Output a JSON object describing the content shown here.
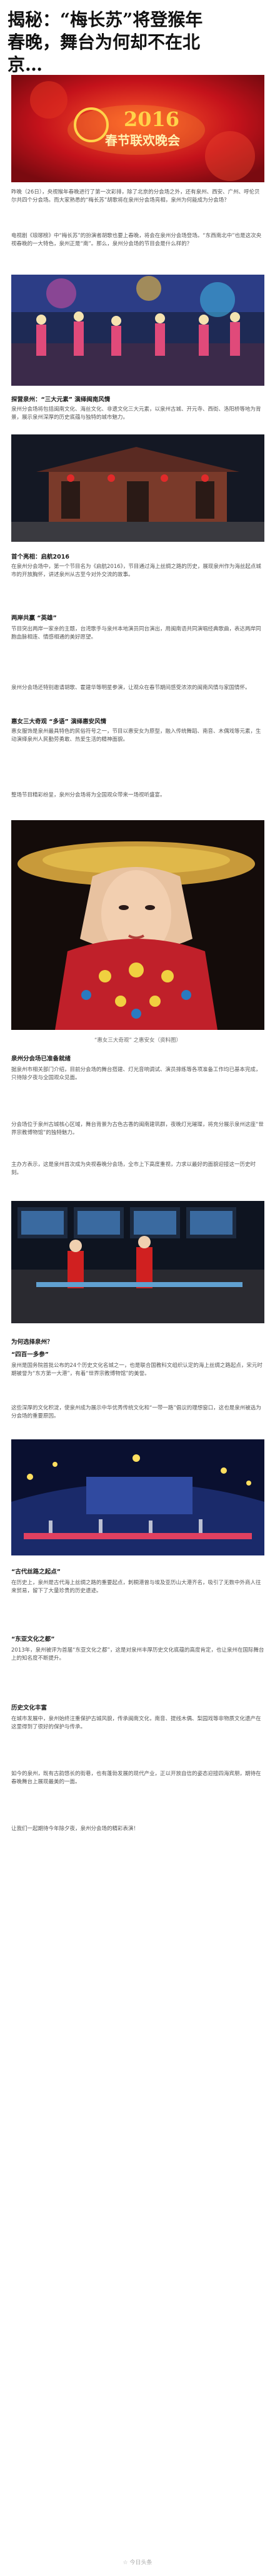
{
  "title_lines": [
    "揭秘：“梅长苏”将登猴年",
    "春晚，舞台为何却不在北",
    "京…"
  ],
  "banner": {
    "year": "2016",
    "label": "春节联欢晚会"
  },
  "p1": "昨晚（26日），央视猴年春晚进行了第一次彩排，除了北京的分会场之外，还有泉州、西安、广州、呼伦贝尔共四个分会场。而大家熟悉的“梅长苏”胡歌将在泉州分会场亮相，泉州为何能成为分会场？",
  "p2": "电视剧《琅琊榜》中“梅长苏”的扮演者胡歌也要上春晚，将会在泉州分会场登场。“东西南北中”也是这次央视春晚的一大特色，泉州正是“南”。那么，泉州分会场的节目会是什么样的？",
  "s1": "探营泉州：“三大元素” 演绎闽南风情",
  "p3": "泉州分会场将包括闽南文化、海丝文化、非遗文化三大元素，以泉州古城、开元寺、西街、洛阳桥等地为背景，展示泉州深厚的历史底蕴与独特的城市魅力。",
  "s2": "首个亮相：启航2016",
  "p4": "在泉州分会场中，第一个节目名为《启航2016》，节目通过海上丝绸之路的历史，展现泉州作为海丝起点城市的开放胸怀，讲述泉州从古至今对外交流的故事。",
  "s3": "两岸共赢 “英雄”",
  "p5": "节目突出两岸一家亲的主题，台湾歌手与泉州本地演员同台演出，用闽南语共同演唱经典歌曲，表达两岸同胞血脉相连、情感相通的美好愿望。",
  "p6": "泉州分会场还特别邀请胡歌、霍建华等明星参演，让观众在春节期间感受浓浓的闽南风情与家国情怀。",
  "s4": "惠女三大奇观 “多语” 演绎惠安风情",
  "p7": "惠女服饰是泉州最具特色的民俗符号之一，节目以惠安女为原型，融入传统舞蹈、南音、木偶戏等元素，生动演绎泉州人民勤劳勇敢、热爱生活的精神面貌。",
  "p8": "整场节目精彩纷呈，泉州分会场将为全国观众带来一场视听盛宴。",
  "cap1": "“惠女三大奇观” 之惠安女（资料图）",
  "s5": "泉州分会场已准备就绪",
  "p9": "据泉州市相关部门介绍，目前分会场的舞台搭建、灯光音响调试、演员排练等各项准备工作均已基本完成，只待除夕夜与全国观众见面。",
  "p10": "分会场位于泉州古城核心区域，舞台背景为古色古香的闽南建筑群，夜晚灯光璀璨，将充分展示泉州这座“世界宗教博物馆”的独特魅力。",
  "p11": "主办方表示，这是泉州首次成为央视春晚分会场，全市上下高度重视，力求以最好的面貌迎接这一历史时刻。",
  "s6": "为何选择泉州？",
  "s7": "“四百一多参”",
  "p12": "泉州是国务院首批公布的24个历史文化名城之一，也是联合国教科文组织认定的海上丝绸之路起点，宋元时期被誉为“东方第一大港”，有着“世界宗教博物馆”的美誉。",
  "p13": "这些深厚的文化积淀，使泉州成为展示中华优秀传统文化和“一带一路”倡议的理想窗口，这也是泉州被选为分会场的重要原因。",
  "s8": "“古代丝路之起点”",
  "p14": "在历史上，泉州是古代海上丝绸之路的重要起点，刺桐港曾与埃及亚历山大港齐名，吸引了无数中外商人往来贸易，留下了大量珍贵的历史遗迹。",
  "s9": "“东亚文化之都”",
  "p15": "2013年，泉州被评为首届“东亚文化之都”，这是对泉州丰厚历史文化底蕴的高度肯定，也让泉州在国际舞台上的知名度不断提升。",
  "s10": "历史文化丰富",
  "p16": "在城市发展中，泉州始终注重保护古城风貌，传承闽南文化，南音、提线木偶、梨园戏等非物质文化遗产在这里得到了很好的保护与传承。",
  "p17": "如今的泉州，既有古韵悠长的街巷，也有蓬勃发展的现代产业，正以开放自信的姿态迎接四海宾朋，期待在春晚舞台上展现最美的一面。",
  "p18": "让我们一起期待今年除夕夜，泉州分会场的精彩表演！",
  "footer": "☆ 今日头条"
}
